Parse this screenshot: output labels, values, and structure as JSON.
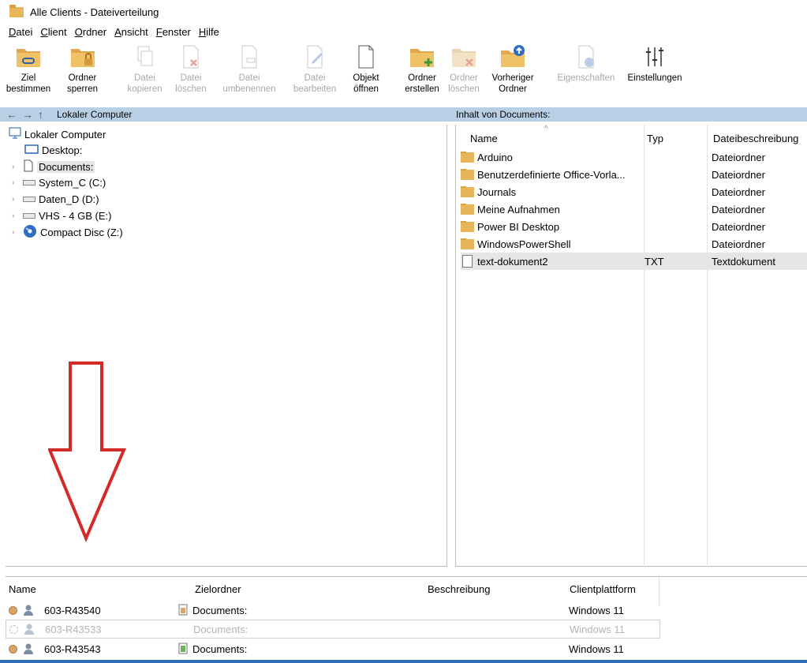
{
  "window": {
    "title": "Alle Clients - Dateiverteilung"
  },
  "menu": [
    "Datei",
    "Client",
    "Ordner",
    "Ansicht",
    "Fenster",
    "Hilfe"
  ],
  "toolbar": [
    {
      "l1": "Ziel",
      "l2": "bestimmen",
      "icon": "folder-link-icon",
      "enabled": true
    },
    {
      "l1": "Ordner",
      "l2": "sperren",
      "icon": "folder-lock-icon",
      "enabled": true
    },
    {
      "l1": "Datei",
      "l2": "kopieren",
      "icon": "copy-file-icon",
      "enabled": false
    },
    {
      "l1": "Datei",
      "l2": "löschen",
      "icon": "delete-file-icon",
      "enabled": false
    },
    {
      "l1": "Datei",
      "l2": "umbenennen",
      "icon": "rename-file-icon",
      "enabled": false
    },
    {
      "l1": "Datei",
      "l2": "bearbeiten",
      "icon": "edit-file-icon",
      "enabled": false
    },
    {
      "l1": "Objekt",
      "l2": "öffnen",
      "icon": "open-object-icon",
      "enabled": true
    },
    {
      "l1": "Ordner",
      "l2": "erstellen",
      "icon": "folder-add-icon",
      "enabled": true
    },
    {
      "l1": "Ordner",
      "l2": "löschen",
      "icon": "folder-delete-icon",
      "enabled": false
    },
    {
      "l1": "Vorheriger",
      "l2": "Ordner",
      "icon": "folder-up-icon",
      "enabled": true
    },
    {
      "l1": "Eigenschaften",
      "l2": "",
      "icon": "properties-icon",
      "enabled": false
    },
    {
      "l1": "Einstellungen",
      "l2": "",
      "icon": "settings-sliders-icon",
      "enabled": true
    }
  ],
  "pathbar": {
    "left": "Lokaler Computer",
    "right": "Inhalt von Documents:"
  },
  "tree": {
    "root": "Lokaler Computer",
    "items": [
      "Desktop:",
      "Documents:",
      "System_C (C:)",
      "Daten_D (D:)",
      "VHS - 4 GB (E:)",
      "Compact Disc (Z:)"
    ]
  },
  "files": {
    "headers": {
      "name": "Name",
      "type": "Typ",
      "desc": "Dateibeschreibung"
    },
    "rows": [
      {
        "name": "Arduino",
        "type": "",
        "desc": "Dateiordner"
      },
      {
        "name": "Benutzerdefinierte Office-Vorla...",
        "type": "",
        "desc": "Dateiordner"
      },
      {
        "name": "Journals",
        "type": "",
        "desc": "Dateiordner"
      },
      {
        "name": "Meine Aufnahmen",
        "type": "",
        "desc": "Dateiordner"
      },
      {
        "name": "Power BI Desktop",
        "type": "",
        "desc": "Dateiordner"
      },
      {
        "name": "WindowsPowerShell",
        "type": "",
        "desc": "Dateiordner"
      },
      {
        "name": "text-dokument2",
        "type": "TXT",
        "desc": "Textdokument"
      }
    ]
  },
  "clients": {
    "headers": {
      "name": "Name",
      "target": "Zielordner",
      "desc": "Beschreibung",
      "platform": "Clientplattform"
    },
    "rows": [
      {
        "name": "603-R43540",
        "target": "Documents:",
        "platform": "Windows 11"
      },
      {
        "name": "603-R43533",
        "target": "Documents:",
        "platform": "Windows 11"
      },
      {
        "name": "603-R43543",
        "target": "Documents:",
        "platform": "Windows 11"
      }
    ]
  }
}
